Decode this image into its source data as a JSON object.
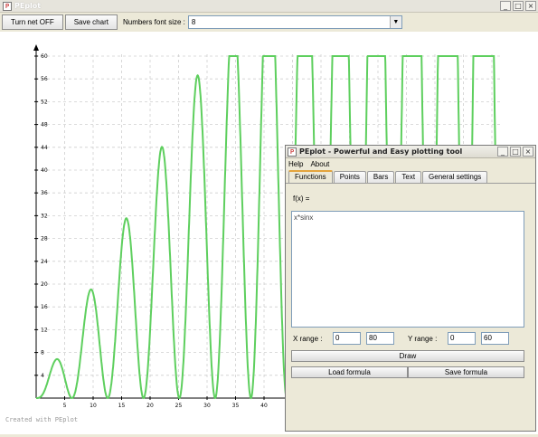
{
  "window": {
    "title": "PEplot"
  },
  "toolbar": {
    "net_button": "Turn net OFF",
    "save_button": "Save chart",
    "font_size_label": "Numbers font size :",
    "font_size_value": "8"
  },
  "chart": {
    "footer": "Created with PEplot",
    "line_color": "#5ecf5e",
    "grid_color": "#cfcfcf"
  },
  "chart_data": {
    "type": "line",
    "function": "x*sinx",
    "x_ticks": [
      "5",
      "10",
      "15",
      "20",
      "25",
      "30",
      "35",
      "40"
    ],
    "y_ticks": [
      "4",
      "8",
      "12",
      "16",
      "20",
      "24",
      "28",
      "32",
      "36",
      "40",
      "44",
      "48",
      "52",
      "56",
      "60"
    ],
    "xlim": [
      0,
      80
    ],
    "ylim": [
      0,
      60
    ],
    "grid": true
  },
  "dialog": {
    "title": "PEplot - Powerful and Easy plotting tool",
    "menu": [
      "Help",
      "About"
    ],
    "tabs": [
      "Functions",
      "Points",
      "Bars",
      "Text",
      "General settings"
    ],
    "fx_label": "f(x) =",
    "formula": "x*sinx",
    "x_range_label": "X range :",
    "x_min": "0",
    "x_max": "80",
    "y_range_label": "Y range :",
    "y_min": "0",
    "y_max": "60",
    "draw_button": "Draw",
    "load_button": "Load formula",
    "save_button": "Save formula"
  }
}
